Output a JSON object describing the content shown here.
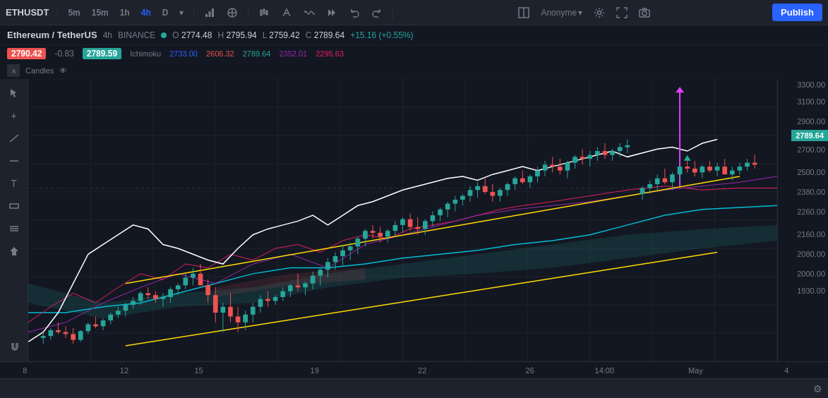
{
  "toolbar": {
    "symbol": "ETHUSDT",
    "timeframes": [
      "5m",
      "15m",
      "1h",
      "4h",
      "D"
    ],
    "active_tf": "4h",
    "publish_label": "Publish",
    "user": "Anonyme",
    "icons": {
      "indicators": "⌥",
      "compare": "⊕",
      "replay": "⏮",
      "undo": "↩",
      "redo": "↪",
      "fullscreen": "⤢",
      "snapshot": "📷",
      "settings": "⚙"
    }
  },
  "symbol_info": {
    "name": "Ethereum / TetherUS",
    "tf": "4h",
    "exchange": "BINANCE",
    "open": "2774.48",
    "high": "2795.94",
    "low": "2759.42",
    "close": "2789.64",
    "change": "+15.16 (+0.55%)"
  },
  "price_display": {
    "current_price": "2790.42",
    "change": "-0.83",
    "close_price": "2789.59",
    "current_label": "2789.64"
  },
  "ichimoku": {
    "label": "Ichimoku",
    "v1": "2733.00",
    "v2": "2606.32",
    "v3": "2789.64",
    "v4": "2352.01",
    "v5": "2295.63",
    "colors": [
      "#2962ff",
      "#ef5350",
      "#26a69a",
      "#9c27b0",
      "#e91e63"
    ]
  },
  "price_levels": [
    {
      "price": "3300.00",
      "pct": 2
    },
    {
      "price": "3100.00",
      "pct": 8
    },
    {
      "price": "2900.00",
      "pct": 15
    },
    {
      "price": "2789.64",
      "pct": 20,
      "current": true
    },
    {
      "price": "2700.00",
      "pct": 25
    },
    {
      "price": "2500.00",
      "pct": 33
    },
    {
      "price": "2380.00",
      "pct": 40
    },
    {
      "price": "2260.00",
      "pct": 47
    },
    {
      "price": "2160.00",
      "pct": 55
    },
    {
      "price": "2080.00",
      "pct": 62
    },
    {
      "price": "2000.00",
      "pct": 69
    },
    {
      "price": "1930.00",
      "pct": 75
    }
  ],
  "time_labels": [
    {
      "label": "8",
      "pct": 3
    },
    {
      "label": "12",
      "pct": 15
    },
    {
      "label": "15",
      "pct": 24
    },
    {
      "label": "19",
      "pct": 38
    },
    {
      "label": "22",
      "pct": 51
    },
    {
      "label": "26",
      "pct": 64
    },
    {
      "label": "14:00",
      "pct": 73
    },
    {
      "label": "May",
      "pct": 84
    },
    {
      "label": "4",
      "pct": 95
    }
  ]
}
